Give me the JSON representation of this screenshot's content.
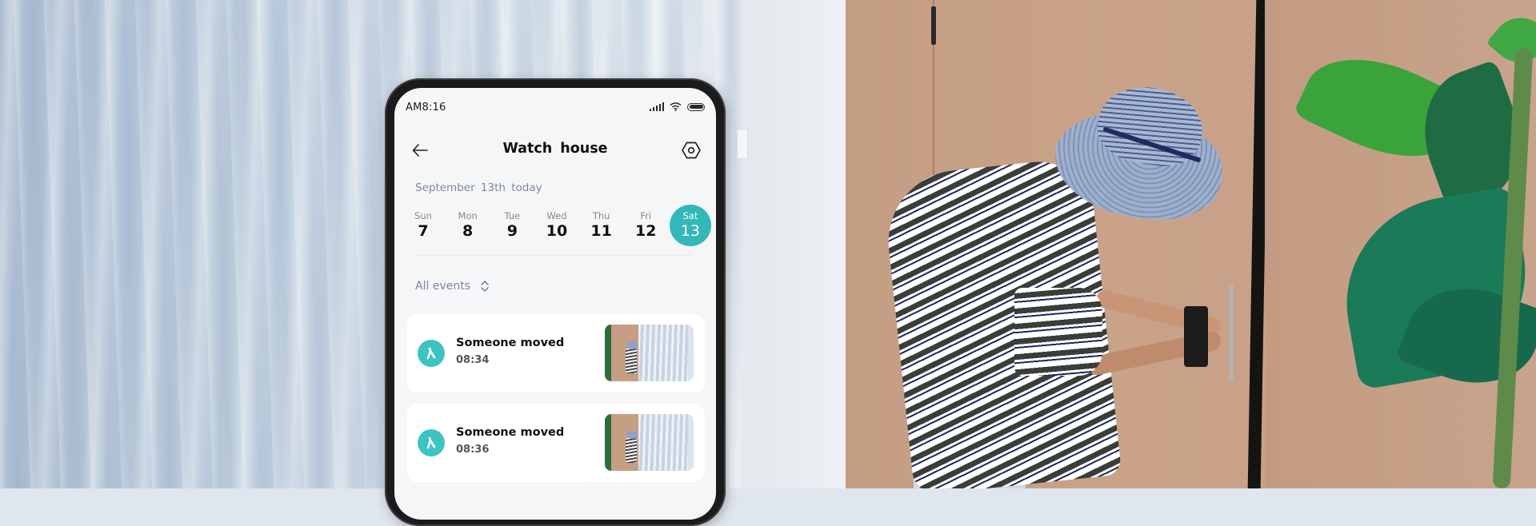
{
  "phone": {
    "status_bar": {
      "time": "AM8:16",
      "icons": [
        "signal-icon",
        "wifi-icon",
        "battery-icon"
      ]
    },
    "header": {
      "back_icon": "arrow-left-icon",
      "title": "Watch  house",
      "settings_icon": "hexagon-settings-icon"
    },
    "date_label": "September 13th  today",
    "week": [
      {
        "name": "Sun",
        "date": "7",
        "selected": false
      },
      {
        "name": "Mon",
        "date": "8",
        "selected": false
      },
      {
        "name": "Tue",
        "date": "9",
        "selected": false
      },
      {
        "name": "Wed",
        "date": "10",
        "selected": false
      },
      {
        "name": "Thu",
        "date": "11",
        "selected": false
      },
      {
        "name": "Fri",
        "date": "12",
        "selected": false
      },
      {
        "name": "Sat",
        "date": "13",
        "selected": true
      }
    ],
    "filter": {
      "label": "All events",
      "icon": "sort-chevrons-icon"
    },
    "events": [
      {
        "icon": "walking-person-icon",
        "title": "Someone moved",
        "time": "08:34",
        "thumbnail": "camera-snapshot"
      },
      {
        "icon": "walking-person-icon",
        "title": "Someone moved",
        "time": "08:36",
        "thumbnail": "camera-snapshot"
      }
    ]
  },
  "colors": {
    "accent": "#33b8ba",
    "event_icon": "#3cc4c2",
    "muted_text": "#7d88a6",
    "screen_bg": "#f5f6f7",
    "card_bg": "#ffffff"
  },
  "background_scene": {
    "left": "sheer blue-white curtain",
    "right": "person in striped shirt and blue bucket hat at wooden door with smart lock, monstera plant"
  }
}
